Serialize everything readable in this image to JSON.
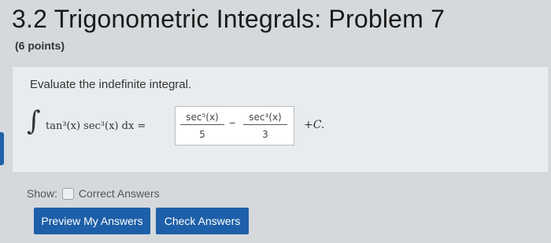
{
  "header": {
    "title": "3.2 Trigonometric Integrals: Problem 7",
    "points": "(6 points)"
  },
  "problem": {
    "prompt": "Evaluate the indefinite integral.",
    "integral_sign": "∫",
    "integrand": "tan³(x) sec³(x) dx =",
    "answer": {
      "frac1_numerator": "sec⁵(x)",
      "frac1_denominator": "5",
      "operator": "−",
      "frac2_numerator": "sec³(x)",
      "frac2_denominator": "3"
    },
    "constant": "+C."
  },
  "options": {
    "show_label": "Show:",
    "correct_answers_label": "Correct Answers"
  },
  "buttons": {
    "preview": "Preview My Answers",
    "check": "Check Answers"
  }
}
